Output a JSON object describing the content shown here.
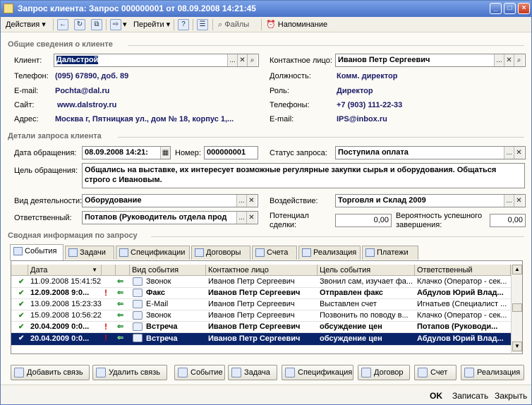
{
  "window": {
    "title": "Запрос клиента: Запрос 000000001 от 08.09.2008 14:21:45"
  },
  "toolbar": {
    "actions": "Действия",
    "goto": "Перейти",
    "files": "Файлы",
    "reminder": "Напоминание"
  },
  "client_info": {
    "section_title": "Общие сведения о клиенте",
    "client_label": "Клиент:",
    "client_value": "Дальстрой",
    "contact_label": "Контактное лицо:",
    "contact_value": "Иванов Петр Сергеевич",
    "phone_label": "Телефон:",
    "phone_value": "(095) 67890, доб. 89",
    "position_label": "Должность:",
    "position_value": "Комм. директор",
    "email_label": "E-mail:",
    "email_value": "Pochta@dal.ru",
    "role_label": "Роль:",
    "role_value": "Директор",
    "site_label": "Сайт:",
    "site_value": "www.dalstroy.ru",
    "phones_label": "Телефоны:",
    "phones_value": "+7 (903) 111-22-33",
    "address_label": "Адрес:",
    "address_value": "Москва г, Пятницкая ул., дом № 18, корпус 1,...",
    "email2_label": "E-mail:",
    "email2_value": "IPS@inbox.ru"
  },
  "request_details": {
    "section_title": "Детали запроса клиента",
    "date_label": "Дата обращения:",
    "date_value": "08.09.2008 14:21:",
    "number_label": "Номер:",
    "number_value": "000000001",
    "status_label": "Статус запроса:",
    "status_value": "Поступила оплата",
    "purpose_label": "Цель обращения:",
    "purpose_value": "Общались на выставке, их интересует возможные регулярные закупки сырья и оборудования. Общаться строго с Ивановым.",
    "activity_label": "Вид деятельности:",
    "activity_value": "Оборудование",
    "impact_label": "Воздействие:",
    "impact_value": "Торговля и Склад 2009",
    "responsible_label": "Ответственный:",
    "responsible_value": "Потапов (Руководитель отдела прод",
    "potential_label": "Потенциал сделки:",
    "potential_value": "0,00",
    "probability_label": "Вероятность успешного завершения:",
    "probability_value": "0,00"
  },
  "summary": {
    "section_title": "Сводная информация по запросу",
    "tabs": [
      {
        "label": "События"
      },
      {
        "label": "Задачи"
      },
      {
        "label": "Спецификации"
      },
      {
        "label": "Договоры"
      },
      {
        "label": "Счета"
      },
      {
        "label": "Реализация"
      },
      {
        "label": "Платежи"
      }
    ],
    "columns": [
      "Дата",
      "Вид события",
      "Контактное лицо",
      "Цель события",
      "Ответственный"
    ],
    "rows": [
      {
        "date": "11.09.2008 15:41:52",
        "type": "Звонок",
        "contact": "Иванов Петр Сергеевич",
        "goal": "Звонил сам, изучает фа...",
        "responsible": "Клачко (Оператор - сек..."
      },
      {
        "date": "12.09.2008 9:0...",
        "type": "Факс",
        "contact": "Иванов Петр Сергеевич",
        "goal": "Отправлен факс",
        "responsible": "Абдулов Юрий Влад..."
      },
      {
        "date": "13.09.2008 15:23:33",
        "type": "E-Mail",
        "contact": "Иванов Петр Сергеевич",
        "goal": "Выставлен счет",
        "responsible": "Игнатьев (Специалист ..."
      },
      {
        "date": "15.09.2008 10:56:22",
        "type": "Звонок",
        "contact": "Иванов Петр Сергеевич",
        "goal": "Позвонить по поводу в...",
        "responsible": "Клачко (Оператор - сек..."
      },
      {
        "date": "20.04.2009 0:0...",
        "type": "Встреча",
        "contact": "Иванов Петр Сергеевич",
        "goal": "обсуждение цен",
        "responsible": "Потапов (Руководи..."
      },
      {
        "date": "20.04.2009 0:0...",
        "type": "Встреча",
        "contact": "Иванов Петр Сергеевич",
        "goal": "обсуждение цен",
        "responsible": "Абдулов Юрий Влад..."
      }
    ]
  },
  "buttons": {
    "add_link": "Добавить связь",
    "remove_link": "Удалить связь",
    "event": "Событие",
    "task": "Задача",
    "spec": "Спецификация",
    "contract": "Договор",
    "invoice": "Счет",
    "sale": "Реализация"
  },
  "footer": {
    "ok": "OK",
    "save": "Записать",
    "close": "Закрыть"
  }
}
